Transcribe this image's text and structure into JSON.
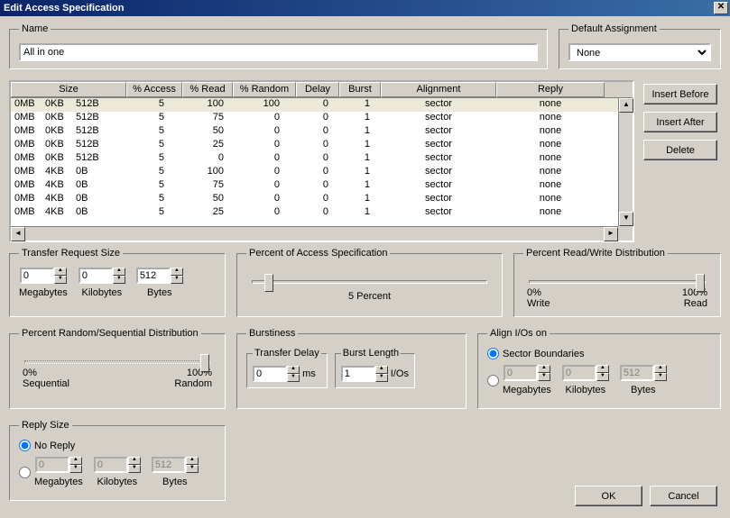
{
  "title": "Edit Access Specification",
  "name": {
    "label": "Name",
    "value": "All in one"
  },
  "default_assignment": {
    "label": "Default Assignment",
    "selected": "None"
  },
  "table": {
    "headers": {
      "size": "Size",
      "access": "% Access",
      "read": "% Read",
      "random": "% Random",
      "delay": "Delay",
      "burst": "Burst",
      "alignment": "Alignment",
      "reply": "Reply"
    },
    "rows": [
      {
        "mb": "0MB",
        "kb": "0KB",
        "b": "512B",
        "access": "5",
        "read": "100",
        "random": "100",
        "delay": "0",
        "burst": "1",
        "align": "sector",
        "reply": "none",
        "sel": true
      },
      {
        "mb": "0MB",
        "kb": "0KB",
        "b": "512B",
        "access": "5",
        "read": "75",
        "random": "0",
        "delay": "0",
        "burst": "1",
        "align": "sector",
        "reply": "none"
      },
      {
        "mb": "0MB",
        "kb": "0KB",
        "b": "512B",
        "access": "5",
        "read": "50",
        "random": "0",
        "delay": "0",
        "burst": "1",
        "align": "sector",
        "reply": "none"
      },
      {
        "mb": "0MB",
        "kb": "0KB",
        "b": "512B",
        "access": "5",
        "read": "25",
        "random": "0",
        "delay": "0",
        "burst": "1",
        "align": "sector",
        "reply": "none"
      },
      {
        "mb": "0MB",
        "kb": "0KB",
        "b": "512B",
        "access": "5",
        "read": "0",
        "random": "0",
        "delay": "0",
        "burst": "1",
        "align": "sector",
        "reply": "none"
      },
      {
        "mb": "0MB",
        "kb": "4KB",
        "b": "0B",
        "access": "5",
        "read": "100",
        "random": "0",
        "delay": "0",
        "burst": "1",
        "align": "sector",
        "reply": "none"
      },
      {
        "mb": "0MB",
        "kb": "4KB",
        "b": "0B",
        "access": "5",
        "read": "75",
        "random": "0",
        "delay": "0",
        "burst": "1",
        "align": "sector",
        "reply": "none"
      },
      {
        "mb": "0MB",
        "kb": "4KB",
        "b": "0B",
        "access": "5",
        "read": "50",
        "random": "0",
        "delay": "0",
        "burst": "1",
        "align": "sector",
        "reply": "none"
      },
      {
        "mb": "0MB",
        "kb": "4KB",
        "b": "0B",
        "access": "5",
        "read": "25",
        "random": "0",
        "delay": "0",
        "burst": "1",
        "align": "sector",
        "reply": "none"
      }
    ]
  },
  "buttons": {
    "insert_before": "Insert Before",
    "insert_after": "Insert After",
    "delete": "Delete",
    "ok": "OK",
    "cancel": "Cancel"
  },
  "transfer_size": {
    "label": "Transfer Request Size",
    "mb": {
      "value": "0",
      "label": "Megabytes"
    },
    "kb": {
      "value": "0",
      "label": "Kilobytes"
    },
    "b": {
      "value": "512",
      "label": "Bytes"
    }
  },
  "pct_spec": {
    "label": "Percent of Access Specification",
    "text": "5 Percent",
    "pos": 5
  },
  "rw_dist": {
    "label": "Percent Read/Write Distribution",
    "left_pct": "0%",
    "left_lbl": "Write",
    "right_pct": "100%",
    "right_lbl": "Read",
    "pos": 100
  },
  "rand_seq": {
    "label": "Percent Random/Sequential Distribution",
    "left_pct": "0%",
    "left_lbl": "Sequential",
    "right_pct": "100%",
    "right_lbl": "Random",
    "pos": 100
  },
  "burstiness": {
    "label": "Burstiness",
    "delay": {
      "label": "Transfer Delay",
      "value": "0",
      "unit": "ms"
    },
    "length": {
      "label": "Burst Length",
      "value": "1",
      "unit": "I/Os"
    }
  },
  "align": {
    "label": "Align I/Os on",
    "sector_label": "Sector Boundaries",
    "sector_checked": true,
    "mb": {
      "value": "0",
      "label": "Megabytes"
    },
    "kb": {
      "value": "0",
      "label": "Kilobytes"
    },
    "b": {
      "value": "512",
      "label": "Bytes"
    }
  },
  "reply": {
    "label": "Reply Size",
    "noreply_label": "No Reply",
    "noreply_checked": true,
    "mb": {
      "value": "0",
      "label": "Megabytes"
    },
    "kb": {
      "value": "0",
      "label": "Kilobytes"
    },
    "b": {
      "value": "512",
      "label": "Bytes"
    }
  }
}
